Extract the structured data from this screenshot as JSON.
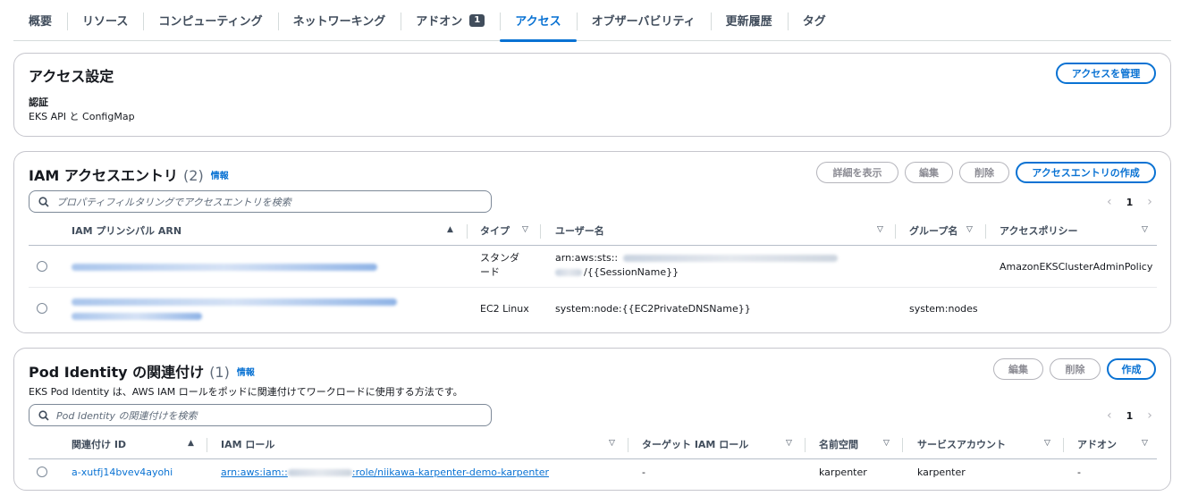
{
  "tabs": [
    {
      "label": "概要"
    },
    {
      "label": "リソース"
    },
    {
      "label": "コンピューティング"
    },
    {
      "label": "ネットワーキング"
    },
    {
      "label": "アドオン",
      "badge": "1"
    },
    {
      "label": "アクセス",
      "active": true
    },
    {
      "label": "オブザーバビリティ"
    },
    {
      "label": "更新履歴"
    },
    {
      "label": "タグ"
    }
  ],
  "access_settings": {
    "title": "アクセス設定",
    "manage_button": "アクセスを管理",
    "auth_label": "認証",
    "auth_value": "EKS API と ConfigMap"
  },
  "iam_entries": {
    "title": "IAM アクセスエントリ",
    "count": "(2)",
    "info": "情報",
    "buttons": {
      "details": "詳細を表示",
      "edit": "編集",
      "delete": "削除",
      "create": "アクセスエントリの作成"
    },
    "search_placeholder": "プロパティフィルタリングでアクセスエントリを検索",
    "page": "1",
    "columns": [
      "IAM プリンシパル ARN",
      "タイプ",
      "ユーザー名",
      "グループ名",
      "アクセスポリシー"
    ],
    "rows": [
      {
        "type_line1": "スタンダ",
        "type_line2": "ード",
        "username_line1": "arn:aws:sts::",
        "username_line2": "/{{SessionName}}",
        "group": "",
        "policy": "AmazonEKSClusterAdminPolicy"
      },
      {
        "type_line1": "EC2 Linux",
        "type_line2": "",
        "username_line1": "system:node:{{EC2PrivateDNSName}}",
        "username_line2": "",
        "group": "system:nodes",
        "policy": ""
      }
    ]
  },
  "pod_identity": {
    "title": "Pod Identity の関連付け",
    "count": "(1)",
    "info": "情報",
    "description": "EKS Pod Identity は、AWS IAM ロールをポッドに関連付けてワークロードに使用する方法です。",
    "buttons": {
      "edit": "編集",
      "delete": "削除",
      "create": "作成"
    },
    "search_placeholder": "Pod Identity の関連付けを検索",
    "page": "1",
    "columns": [
      "関連付け ID",
      "IAM ロール",
      "ターゲット IAM ロール",
      "名前空間",
      "サービスアカウント",
      "アドオン"
    ],
    "rows": [
      {
        "id": "a-xutfj14bvev4ayohi",
        "role_prefix": "arn:aws:iam::",
        "role_suffix": ":role/niikawa-karpenter-demo-karpenter",
        "target": "-",
        "namespace": "karpenter",
        "service_account": "karpenter",
        "addon": "-"
      }
    ]
  }
}
